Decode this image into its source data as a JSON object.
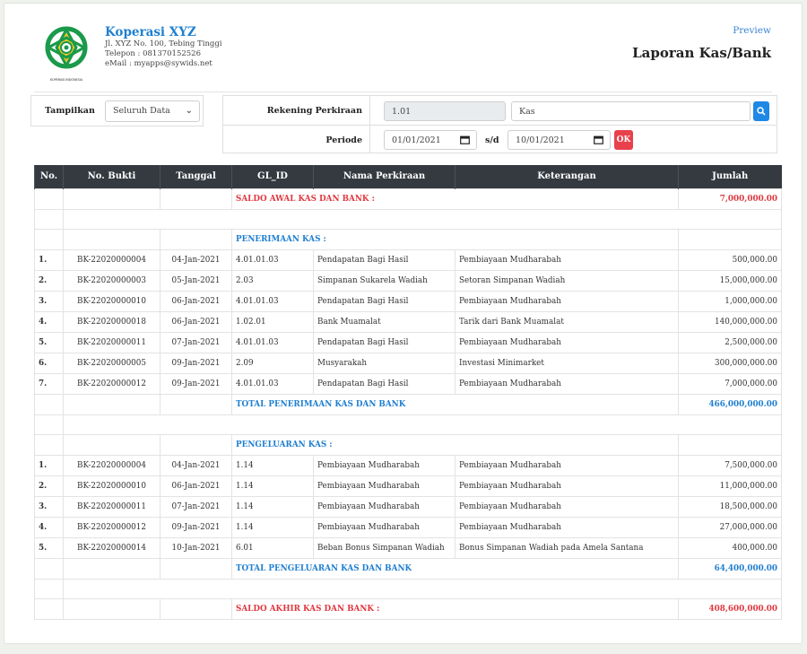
{
  "org": {
    "name": "Koperasi XYZ",
    "address": "Jl. XYZ No. 100, Tebing Tinggi",
    "phone": "Telepon : 081370152526",
    "email": "eMail : myapps@sywids.net",
    "logo_caption": "KOPERASI INDONESIA"
  },
  "header": {
    "preview_link": "Preview",
    "title": "Laporan Kas/Bank"
  },
  "filters": {
    "show_label": "Tampilkan",
    "show_value": "Seluruh Data",
    "account_label": "Rekening Perkiraan",
    "account_code": "1.01",
    "account_name": "Kas",
    "period_label": "Periode",
    "date_from": "01/01/2021",
    "sd_label": "s/d",
    "date_to": "10/01/2021",
    "ok_label": "OK"
  },
  "table": {
    "headers": [
      "No.",
      "No. Bukti",
      "Tanggal",
      "GL_ID",
      "Nama Perkiraan",
      "Keterangan",
      "Jumlah"
    ],
    "opening": {
      "label": "SALDO AWAL KAS DAN BANK :",
      "amount": "7,000,000.00"
    },
    "receipts": {
      "label": "PENERIMAAN KAS :",
      "rows": [
        {
          "no": "1.",
          "bukti": "BK-22020000004",
          "tanggal": "04-Jan-2021",
          "gl": "4.01.01.03",
          "nama": "Pendapatan Bagi Hasil",
          "ket": "Pembiayaan Mudharabah",
          "jumlah": "500,000.00"
        },
        {
          "no": "2.",
          "bukti": "BK-22020000003",
          "tanggal": "05-Jan-2021",
          "gl": "2.03",
          "nama": "Simpanan Sukarela Wadiah",
          "ket": "Setoran Simpanan Wadiah",
          "jumlah": "15,000,000.00"
        },
        {
          "no": "3.",
          "bukti": "BK-22020000010",
          "tanggal": "06-Jan-2021",
          "gl": "4.01.01.03",
          "nama": "Pendapatan Bagi Hasil",
          "ket": "Pembiayaan Mudharabah",
          "jumlah": "1,000,000.00"
        },
        {
          "no": "4.",
          "bukti": "BK-22020000018",
          "tanggal": "06-Jan-2021",
          "gl": "1.02.01",
          "nama": "Bank Muamalat",
          "ket": "Tarik dari Bank Muamalat",
          "jumlah": "140,000,000.00"
        },
        {
          "no": "5.",
          "bukti": "BK-22020000011",
          "tanggal": "07-Jan-2021",
          "gl": "4.01.01.03",
          "nama": "Pendapatan Bagi Hasil",
          "ket": "Pembiayaan Mudharabah",
          "jumlah": "2,500,000.00"
        },
        {
          "no": "6.",
          "bukti": "BK-22020000005",
          "tanggal": "09-Jan-2021",
          "gl": "2.09",
          "nama": "Musyarakah",
          "ket": "Investasi Minimarket",
          "jumlah": "300,000,000.00"
        },
        {
          "no": "7.",
          "bukti": "BK-22020000012",
          "tanggal": "09-Jan-2021",
          "gl": "4.01.01.03",
          "nama": "Pendapatan Bagi Hasil",
          "ket": "Pembiayaan Mudharabah",
          "jumlah": "7,000,000.00"
        }
      ],
      "total_label": "TOTAL PENERIMAAN KAS DAN BANK",
      "total_amount": "466,000,000.00"
    },
    "payments": {
      "label": "PENGELUARAN KAS :",
      "rows": [
        {
          "no": "1.",
          "bukti": "BK-22020000004",
          "tanggal": "04-Jan-2021",
          "gl": "1.14",
          "nama": "Pembiayaan Mudharabah",
          "ket": "Pembiayaan Mudharabah",
          "jumlah": "7,500,000.00"
        },
        {
          "no": "2.",
          "bukti": "BK-22020000010",
          "tanggal": "06-Jan-2021",
          "gl": "1.14",
          "nama": "Pembiayaan Mudharabah",
          "ket": "Pembiayaan Mudharabah",
          "jumlah": "11,000,000.00"
        },
        {
          "no": "3.",
          "bukti": "BK-22020000011",
          "tanggal": "07-Jan-2021",
          "gl": "1.14",
          "nama": "Pembiayaan Mudharabah",
          "ket": "Pembiayaan Mudharabah",
          "jumlah": "18,500,000.00"
        },
        {
          "no": "4.",
          "bukti": "BK-22020000012",
          "tanggal": "09-Jan-2021",
          "gl": "1.14",
          "nama": "Pembiayaan Mudharabah",
          "ket": "Pembiayaan Mudharabah",
          "jumlah": "27,000,000.00"
        },
        {
          "no": "5.",
          "bukti": "BK-22020000014",
          "tanggal": "10-Jan-2021",
          "gl": "6.01",
          "nama": "Beban Bonus Simpanan Wadiah",
          "ket": "Bonus Simpanan Wadiah pada Amela Santana",
          "jumlah": "400,000.00"
        }
      ],
      "total_label": "TOTAL PENGELUARAN KAS DAN BANK",
      "total_amount": "64,400,000.00"
    },
    "closing": {
      "label": "SALDO AKHIR KAS DAN BANK :",
      "amount": "408,600,000.00"
    }
  },
  "colors": {
    "brand_blue": "#1f7fd0",
    "alert_red": "#e0383f",
    "header_dark": "#343a40",
    "logo_green": "#1a9a4a"
  }
}
